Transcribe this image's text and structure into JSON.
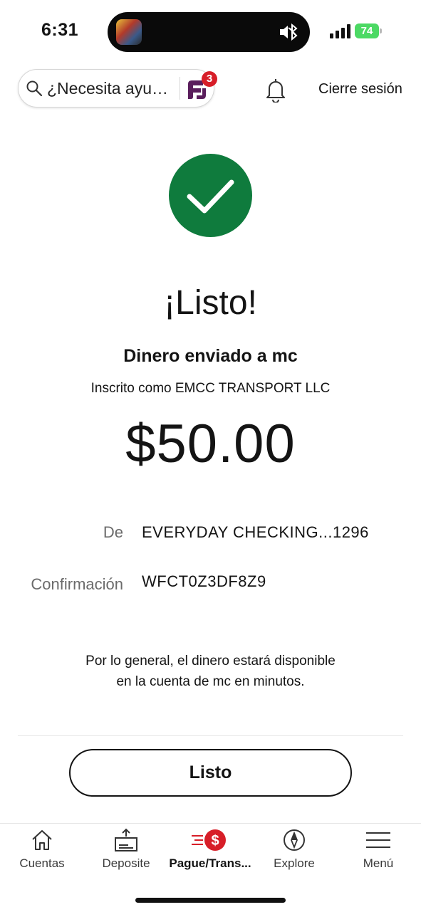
{
  "status_bar": {
    "time": "6:31",
    "battery": "74"
  },
  "header": {
    "search_placeholder": "¿Necesita ayu…",
    "notification_badge": "3",
    "signout_label": "Cierre sesión"
  },
  "confirmation": {
    "headline": "¡Listo!",
    "sent_to": "Dinero enviado a mc",
    "enrolled_as": "Inscrito como EMCC TRANSPORT LLC",
    "amount": "$50.00",
    "from_label": "De",
    "from_value": "EVERYDAY CHECKING...1296",
    "confirmation_label": "Confirmación",
    "confirmation_value": "WFCT0Z3DF8Z9",
    "note_line1": "Por lo general, el dinero estará disponible",
    "note_line2": "en la cuenta de mc en minutos.",
    "done_label": "Listo"
  },
  "nav": {
    "items": [
      {
        "label": "Cuentas",
        "icon": "home-icon"
      },
      {
        "label": "Deposite",
        "icon": "deposit-icon"
      },
      {
        "label": "Pague/Trans...",
        "icon": "pay-transfer-icon",
        "active": true
      },
      {
        "label": "Explore",
        "icon": "compass-icon"
      },
      {
        "label": "Menú",
        "icon": "menu-icon"
      }
    ]
  },
  "colors": {
    "success_green": "#0f7b3d",
    "brand_red": "#d71e28",
    "fargo_purple": "#5a1e5c",
    "battery_green": "#4cd964"
  }
}
